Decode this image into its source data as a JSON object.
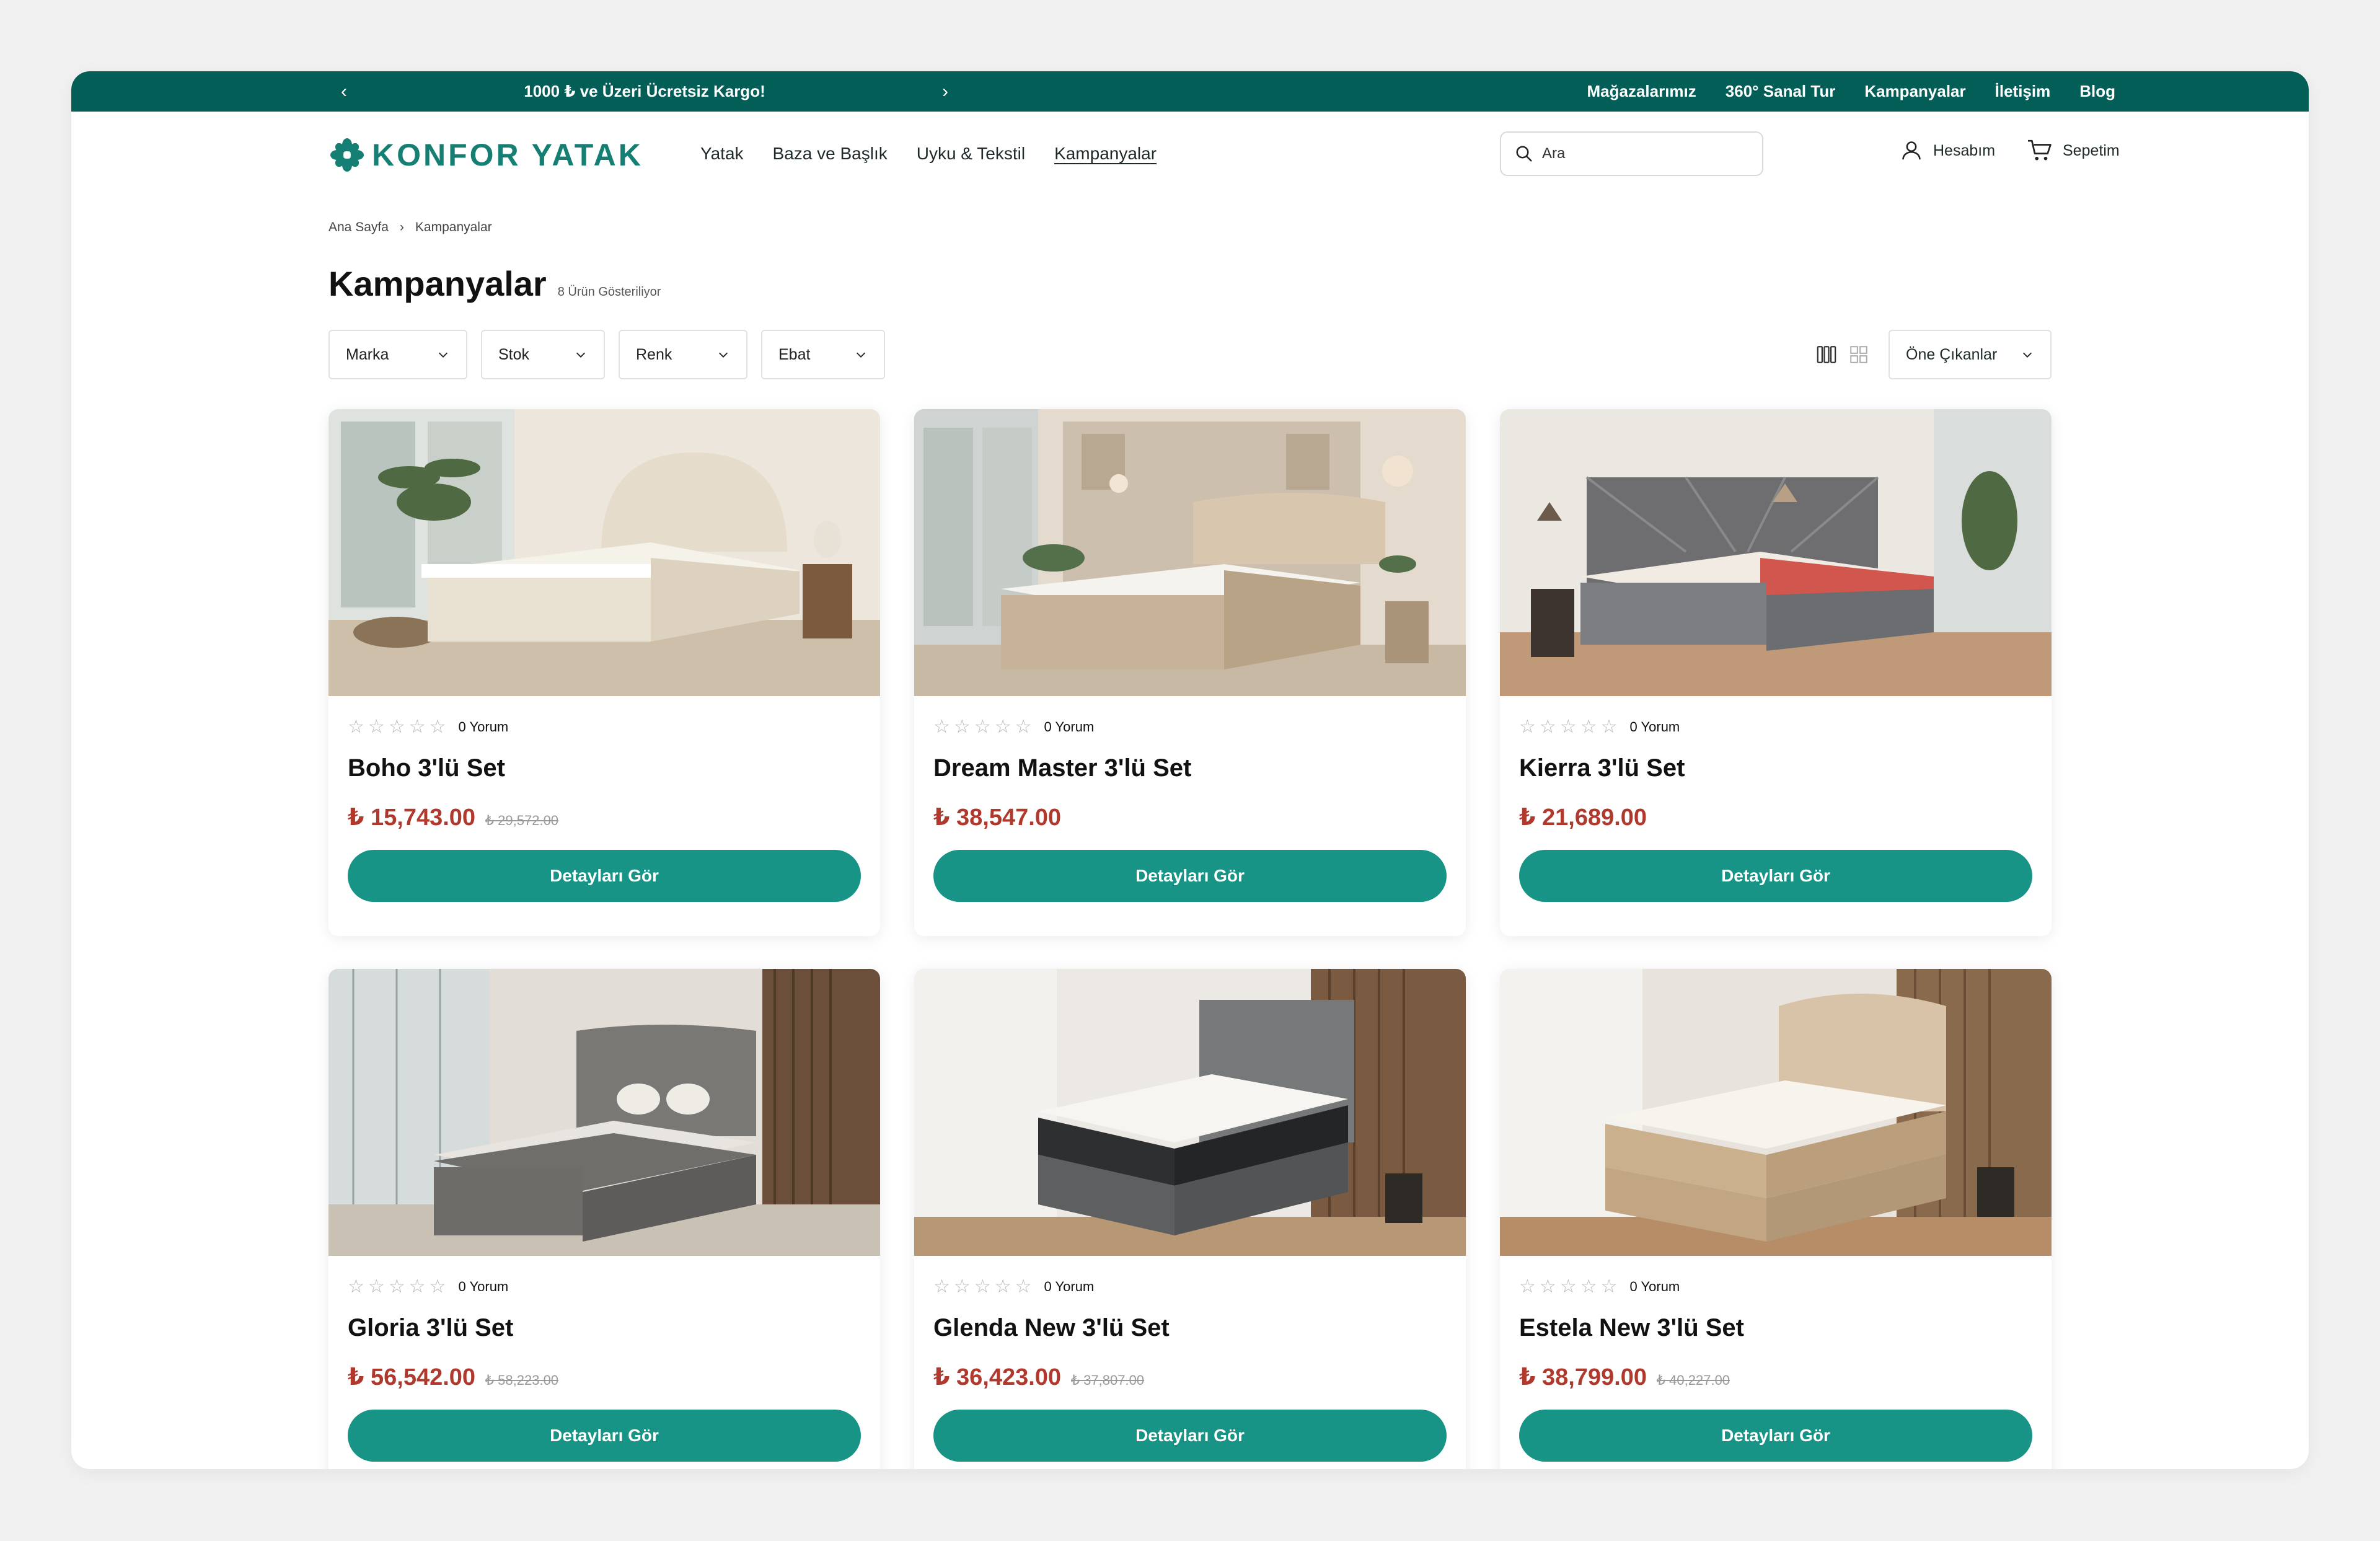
{
  "topbar": {
    "promo": "1000 ₺ ve Üzeri Ücretsiz Kargo!",
    "prev_icon": "chevron-left-icon",
    "next_icon": "chevron-right-icon",
    "links": [
      "Mağazalarımız",
      "360° Sanal Tur",
      "Kampanyalar",
      "İletişim",
      "Blog"
    ]
  },
  "header": {
    "logo_text": "KONFOR YATAK",
    "nav": [
      "Yatak",
      "Baza ve Başlık",
      "Uyku & Tekstil",
      "Kampanyalar"
    ],
    "active_nav": "Kampanyalar",
    "search_placeholder": "Ara",
    "account_label": "Hesabım",
    "cart_label": "Sepetim"
  },
  "breadcrumb": [
    "Ana Sayfa",
    "Kampanyalar"
  ],
  "page": {
    "title": "Kampanyalar",
    "count": "8 Ürün Gösteriliyor"
  },
  "filters": [
    "Marka",
    "Stok",
    "Renk",
    "Ebat"
  ],
  "sort": {
    "selected": "Öne Çıkanlar"
  },
  "colors": {
    "brand": "#035e58",
    "accent": "#179485",
    "price": "#b0392e"
  },
  "products": [
    {
      "name": "Boho 3'lü Set",
      "reviews": "0 Yorum",
      "price": "₺ 15,743.00",
      "old_price": "₺ 29,572.00",
      "button": "Detayları Gör",
      "rating": 0
    },
    {
      "name": "Dream Master 3'lü Set",
      "reviews": "0 Yorum",
      "price": "₺ 38,547.00",
      "old_price": "",
      "button": "Detayları Gör",
      "rating": 0
    },
    {
      "name": "Kierra 3'lü Set",
      "reviews": "0 Yorum",
      "price": "₺ 21,689.00",
      "old_price": "",
      "button": "Detayları Gör",
      "rating": 0
    },
    {
      "name": "Gloria 3'lü Set",
      "reviews": "0 Yorum",
      "price": "₺ 56,542.00",
      "old_price": "₺ 58,223.00",
      "button": "Detayları Gör",
      "rating": 0
    },
    {
      "name": "Glenda New 3'lü Set",
      "reviews": "0 Yorum",
      "price": "₺ 36,423.00",
      "old_price": "₺ 37,807.00",
      "button": "Detayları Gör",
      "rating": 0
    },
    {
      "name": "Estela New 3'lü Set",
      "reviews": "0 Yorum",
      "price": "₺ 38,799.00",
      "old_price": "₺ 40,227.00",
      "button": "Detayları Gör",
      "rating": 0
    }
  ]
}
